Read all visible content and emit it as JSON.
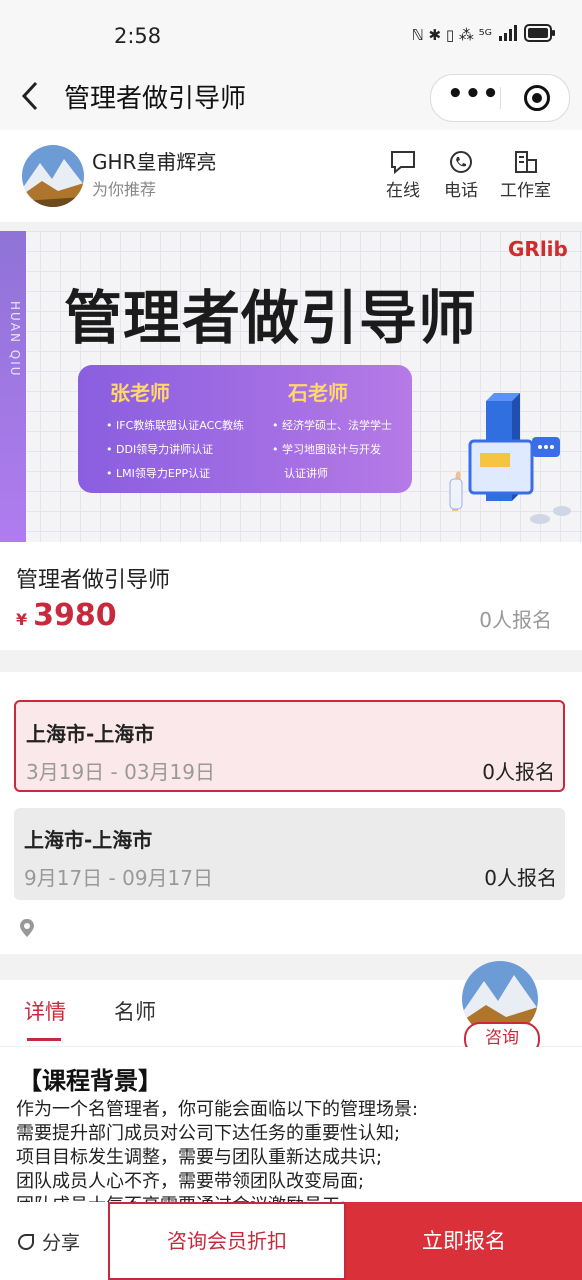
{
  "status_bar": {
    "time": "2:58",
    "icons_text": "ℕ ✱ ▯ ⁂ ⁵ᴳ",
    "battery": "▭"
  },
  "nav": {
    "title": "管理者做引导师",
    "more_label": "•••"
  },
  "org": {
    "name": "GHR皇甫辉亮",
    "subtitle": "为你推荐",
    "actions": [
      {
        "label": "在线",
        "icon": "chat-bubble-icon"
      },
      {
        "label": "电话",
        "icon": "phone-icon"
      },
      {
        "label": "工作室",
        "icon": "building-icon"
      }
    ]
  },
  "banner": {
    "title": "管理者做引导师",
    "side_text": "HUAN QIU",
    "logo": "GRlib",
    "teachers": [
      {
        "name": "张老师",
        "items": [
          "IFC教练联盟认证ACC教练",
          "DDI领导力讲师认证",
          "LMI领导力EPP认证"
        ]
      },
      {
        "name": "石老师",
        "items": [
          "经济学硕士、法学学士",
          "学习地图设计与开发",
          "认证讲师"
        ]
      }
    ]
  },
  "course": {
    "title": "管理者做引导师",
    "currency": "¥",
    "price": "3980",
    "signup_count": "0人报名"
  },
  "sessions": [
    {
      "city": "上海市-上海市",
      "dates": "3月19日 - 03月19日",
      "count": "0人报名",
      "selected": true
    },
    {
      "city": "上海市-上海市",
      "dates": "9月17日 - 09月17日",
      "count": "0人报名",
      "selected": false
    }
  ],
  "tabs": [
    {
      "label": "详情",
      "active": true
    },
    {
      "label": "名师",
      "active": false
    }
  ],
  "consult_label": "咨询",
  "content": {
    "section_title": "【课程背景】",
    "lines": [
      "作为一个名管理者，你可能会面临以下的管理场景:",
      "需要提升部门成员对公司下达任务的重要性认知;",
      "项目目标发生调整，需要与团队重新达成共识;",
      "团队成员人心不齐，需要带领团队改变局面;",
      "团队成员士气不高需要通过会议激励员工;"
    ]
  },
  "bottom": {
    "share_label": "分享",
    "member_label": "咨询会员折扣",
    "signup_label": "立即报名"
  },
  "colors": {
    "accent": "#c9293c",
    "cta": "#d9303a",
    "banner_purple": "#9a68e0"
  }
}
